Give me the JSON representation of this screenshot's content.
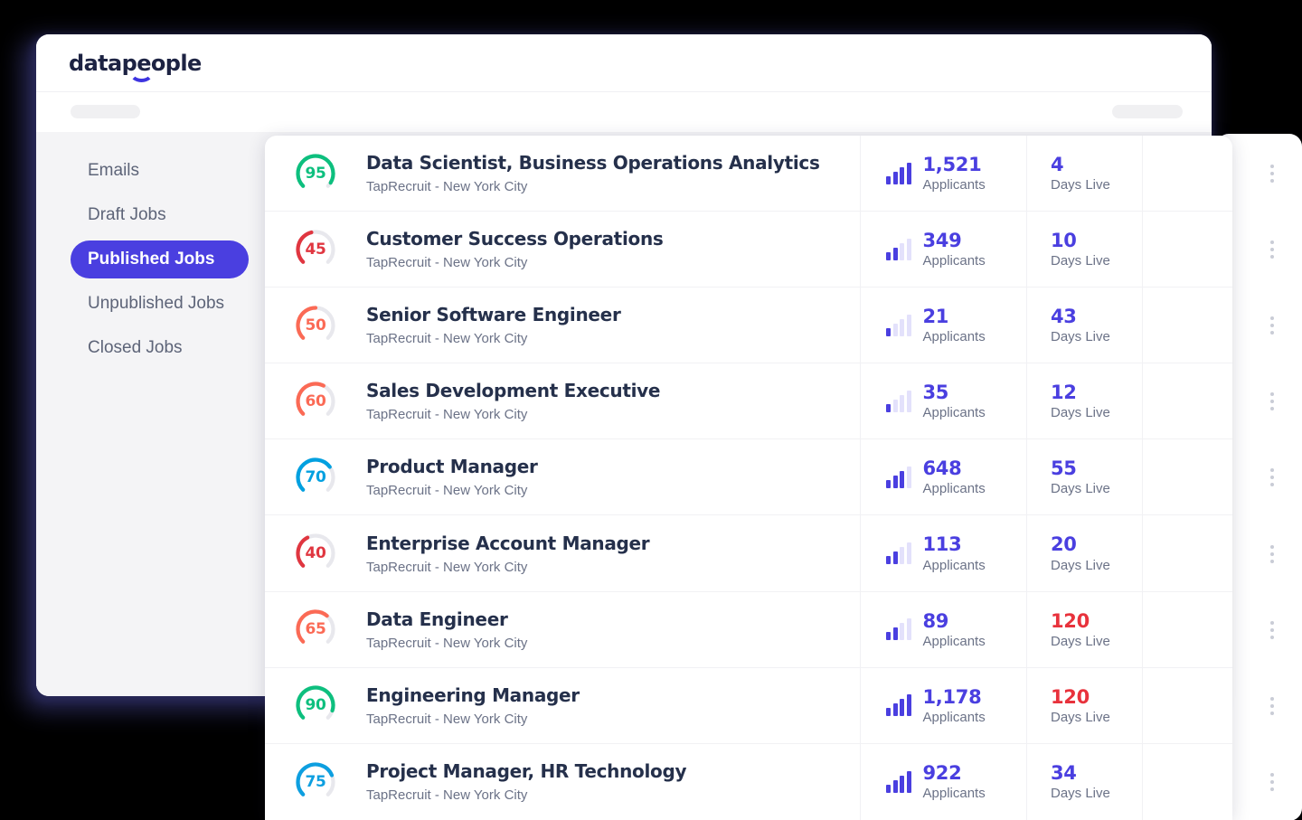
{
  "brand": {
    "logo_text": "datapeople",
    "accent_color": "#4a3fe0",
    "logo_color": "#1d2343"
  },
  "toolbar": {
    "left_placeholder": "",
    "right_placeholder": ""
  },
  "sidebar": {
    "items": [
      {
        "label": "Emails",
        "active": false
      },
      {
        "label": "Draft Jobs",
        "active": false
      },
      {
        "label": "Published Jobs",
        "active": true
      },
      {
        "label": "Unpublished Jobs",
        "active": false
      },
      {
        "label": "Closed Jobs",
        "active": false
      }
    ]
  },
  "job_list": {
    "applicants_label": "Applicants",
    "days_label": "Days Live",
    "menu_icon": "kebab-menu-icon",
    "rows": [
      {
        "score": "95",
        "score_color": "#0dbf7e",
        "score_pct": 95,
        "title": "Data Scientist, Business Operations Analytics",
        "subtitle": "TapRecruit - New York City",
        "applicants": "1,521",
        "applicants_level": 4,
        "days": "4",
        "days_alert": false
      },
      {
        "score": "45",
        "score_color": "#e03640",
        "score_pct": 45,
        "title": "Customer Success Operations",
        "subtitle": "TapRecruit - New York City",
        "applicants": "349",
        "applicants_level": 2,
        "days": "10",
        "days_alert": false
      },
      {
        "score": "50",
        "score_color": "#fb6a55",
        "score_pct": 50,
        "title": "Senior Software Engineer",
        "subtitle": "TapRecruit - New York City",
        "applicants": "21",
        "applicants_level": 1,
        "days": "43",
        "days_alert": false
      },
      {
        "score": "60",
        "score_color": "#fb6a55",
        "score_pct": 60,
        "title": "Sales Development Executive",
        "subtitle": "TapRecruit - New York City",
        "applicants": "35",
        "applicants_level": 1,
        "days": "12",
        "days_alert": false
      },
      {
        "score": "70",
        "score_color": "#00a0e0",
        "score_pct": 70,
        "title": "Product Manager",
        "subtitle": "TapRecruit - New York City",
        "applicants": "648",
        "applicants_level": 3,
        "days": "55",
        "days_alert": false
      },
      {
        "score": "40",
        "score_color": "#e03640",
        "score_pct": 40,
        "title": "Enterprise Account Manager",
        "subtitle": "TapRecruit - New York City",
        "applicants": "113",
        "applicants_level": 2,
        "days": "20",
        "days_alert": false
      },
      {
        "score": "65",
        "score_color": "#fb6a55",
        "score_pct": 65,
        "title": "Data Engineer",
        "subtitle": "TapRecruit - New York City",
        "applicants": "89",
        "applicants_level": 2,
        "days": "120",
        "days_alert": true
      },
      {
        "score": "90",
        "score_color": "#0dbf7e",
        "score_pct": 90,
        "title": "Engineering Manager",
        "subtitle": "TapRecruit - New York City",
        "applicants": "1,178",
        "applicants_level": 4,
        "days": "120",
        "days_alert": true
      },
      {
        "score": "75",
        "score_color": "#0d9fe0",
        "score_pct": 75,
        "title": "Project Manager, HR Technology",
        "subtitle": "TapRecruit - New York City",
        "applicants": "922",
        "applicants_level": 4,
        "days": "34",
        "days_alert": false
      }
    ]
  }
}
